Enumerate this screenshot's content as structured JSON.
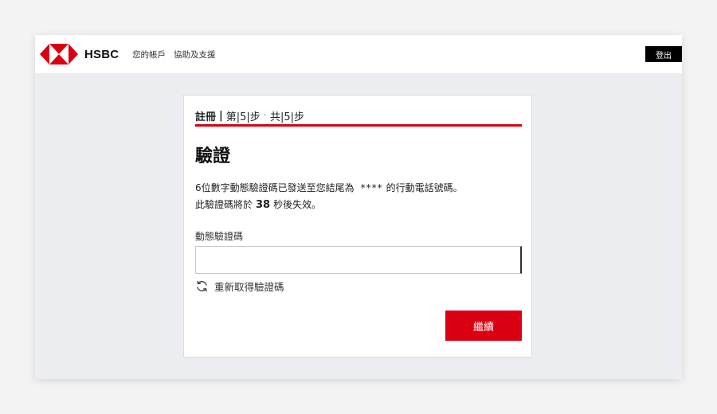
{
  "brand": {
    "name": "HSBC",
    "color": "#db0011"
  },
  "nav": {
    "accounts": "您的帳戶",
    "help": "協助及支援"
  },
  "header": {
    "logout_label": "登出"
  },
  "step": {
    "section": "註冊",
    "separator": "|",
    "current": "第|5|步",
    "dot": "·",
    "total": "共|5|步"
  },
  "card": {
    "title": "驗證",
    "message_part1": "6位數字動態驗證碼已發送至您結尾為",
    "masked_number": "****",
    "message_part2": "的行動電話號碼。",
    "expiry_part1": "此驗證碼將於",
    "expiry_seconds": "38",
    "expiry_part2": "秒後失效。",
    "field_label": "動態驗證碼",
    "field_value": "",
    "resend_label": "重新取得驗證碼",
    "continue_label": "繼續"
  },
  "icons": {
    "logo": "hsbc-hexagon-logo-icon",
    "resend": "refresh-icon"
  }
}
